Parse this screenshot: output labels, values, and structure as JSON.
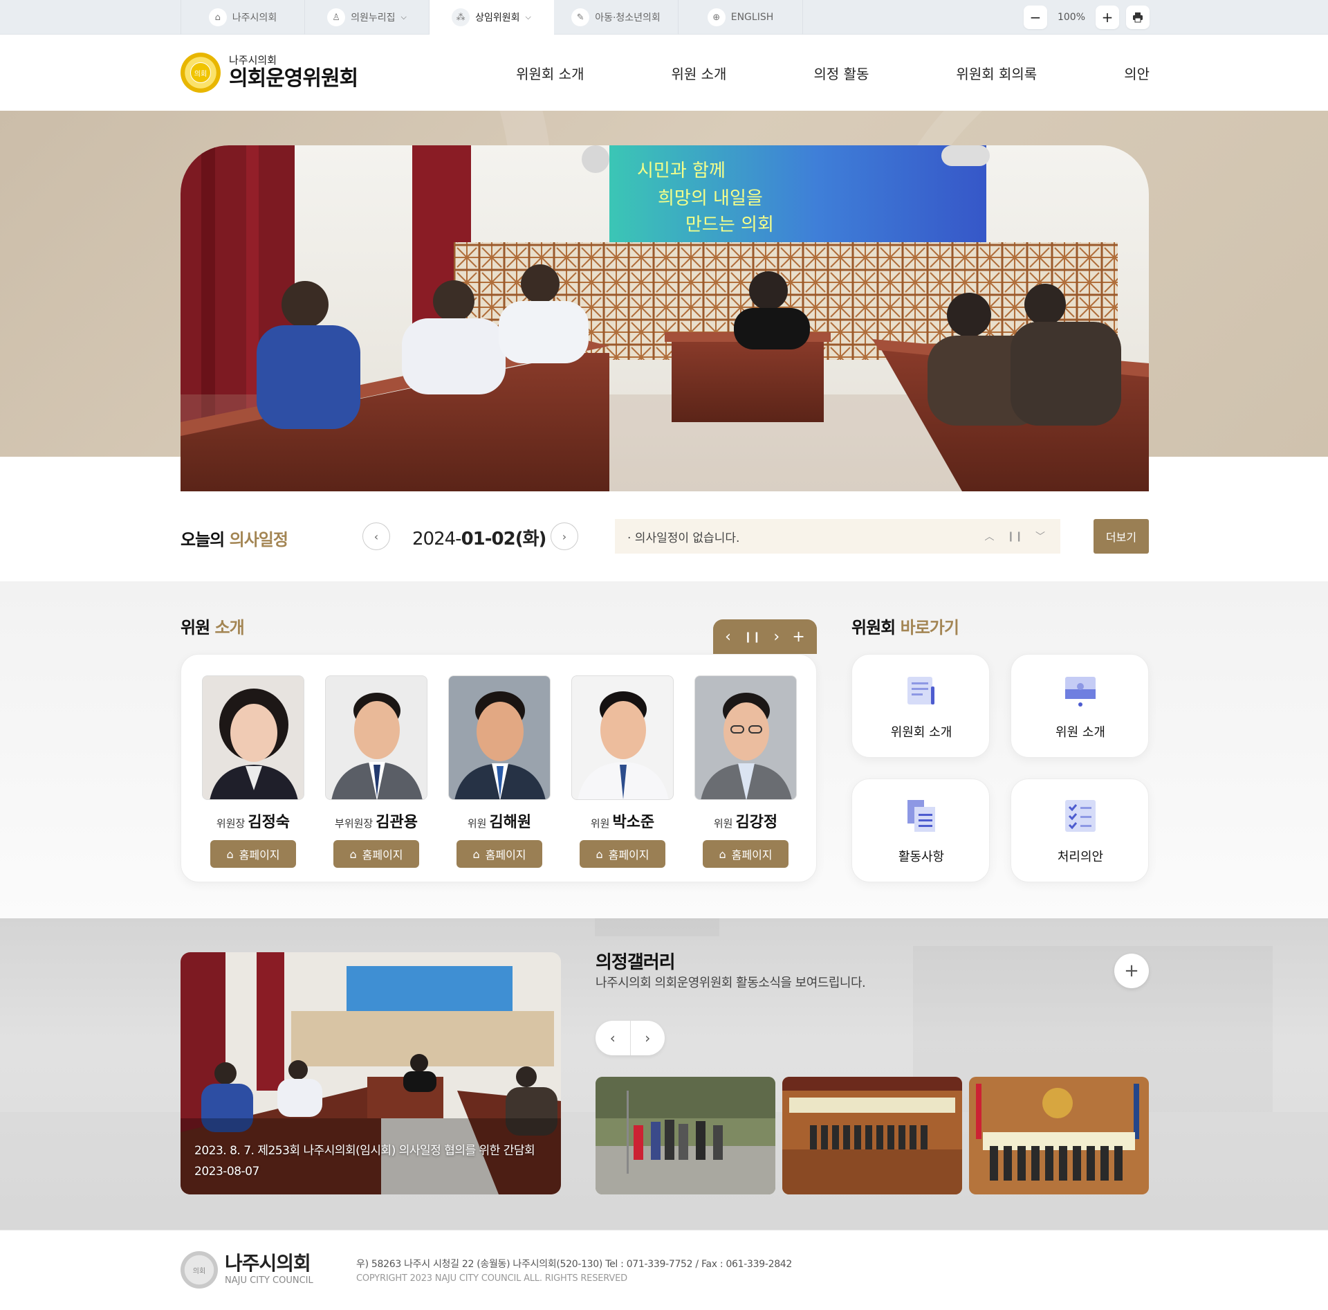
{
  "util_tabs": [
    {
      "label": "나주시의회",
      "icon": "home-icon",
      "dropdown": false
    },
    {
      "label": "의원누리집",
      "icon": "user-icon",
      "dropdown": true
    },
    {
      "label": "상임위원회",
      "icon": "org-icon",
      "dropdown": true
    },
    {
      "label": "아동·청소년의회",
      "icon": "pen-icon",
      "dropdown": false
    },
    {
      "label": "ENGLISH",
      "icon": "globe-icon",
      "dropdown": false
    }
  ],
  "zoom": {
    "value": "100%"
  },
  "logo": {
    "sub": "나주시의회",
    "main": "의회운영위원회",
    "seal": "의회"
  },
  "gnb": [
    "위원회 소개",
    "위원 소개",
    "의정 활동",
    "위원회 회의록",
    "의안"
  ],
  "today": {
    "title_a": "오늘의",
    "title_b": "의사일정",
    "date_pre": "2024-",
    "date_bold": "01-02(화)",
    "notice": "· 의사일정이 없습니다.",
    "more": "더보기"
  },
  "members_section": {
    "title_a": "위원",
    "title_b": "소개"
  },
  "members": [
    {
      "role": "위원장",
      "name": "김정숙",
      "hp": "홈페이지"
    },
    {
      "role": "부위원장",
      "name": "김관용",
      "hp": "홈페이지"
    },
    {
      "role": "위원",
      "name": "김해원",
      "hp": "홈페이지"
    },
    {
      "role": "위원",
      "name": "박소준",
      "hp": "홈페이지"
    },
    {
      "role": "위원",
      "name": "김강정",
      "hp": "홈페이지"
    }
  ],
  "quick_section": {
    "title_a": "위원회",
    "title_b": "바로가기"
  },
  "quick": [
    {
      "label": "위원회 소개",
      "icon": "document-icon"
    },
    {
      "label": "위원 소개",
      "icon": "podium-icon"
    },
    {
      "label": "활동사항",
      "icon": "files-icon"
    },
    {
      "label": "처리의안",
      "icon": "checklist-icon"
    }
  ],
  "gallery": {
    "title": "의정갤러리",
    "desc": "나주시의회 의회운영위원회 활동소식을 보여드립니다.",
    "caption": "2023. 8. 7. 제253회 나주시의회(임시회) 의사일정 협의를 위한 간담회",
    "date": "2023-08-07"
  },
  "footer": {
    "name": "나주시의회",
    "en": "NAJU CITY COUNCIL",
    "seal": "의회",
    "address": "우) 58263 나주시 시청길 22 (송월동) 나주시의회(520-130) Tel : 071-339-7752 / Fax : 061-339-2842",
    "copyright": "COPYRIGHT   2023 NAJU CITY COUNCIL ALL. RIGHTS RESERVED"
  },
  "banner_text": [
    "시민과 함께",
    "희망의 내일을",
    "만드는 의회"
  ],
  "colors": {
    "accent": "#9a7f54",
    "accent_text": "#a38553",
    "notice_bg": "#f8f3ea"
  }
}
